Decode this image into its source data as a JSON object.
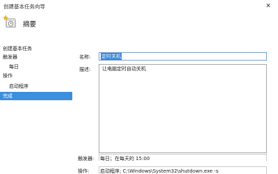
{
  "window": {
    "title": "创建基本任务向导",
    "close_glyph": "✕"
  },
  "header": {
    "title": "摘要",
    "icon": "task-wizard-icon"
  },
  "sidebar": {
    "items": [
      {
        "label": "创建基本任务",
        "level": 1,
        "selected": false
      },
      {
        "label": "触发器",
        "level": 1,
        "selected": false
      },
      {
        "label": "每日",
        "level": 2,
        "selected": false
      },
      {
        "label": "操作",
        "level": 1,
        "selected": false
      },
      {
        "label": "启动程序",
        "level": 2,
        "selected": false
      },
      {
        "label": "完成",
        "level": 1,
        "selected": true
      }
    ]
  },
  "form": {
    "name_label": "名称:",
    "name_value": "定时关机",
    "description_label": "描述:",
    "description_value": "让电脑定时自动关机",
    "trigger_label": "触发器:",
    "trigger_value": "每日；在每天的 15:00",
    "action_label": "操作:",
    "action_value": "启动程序; C:\\Windows\\System32\\shutdown.exe -s"
  },
  "colors": {
    "selection": "#3b8fdc",
    "name_highlight": "#3584d8"
  }
}
